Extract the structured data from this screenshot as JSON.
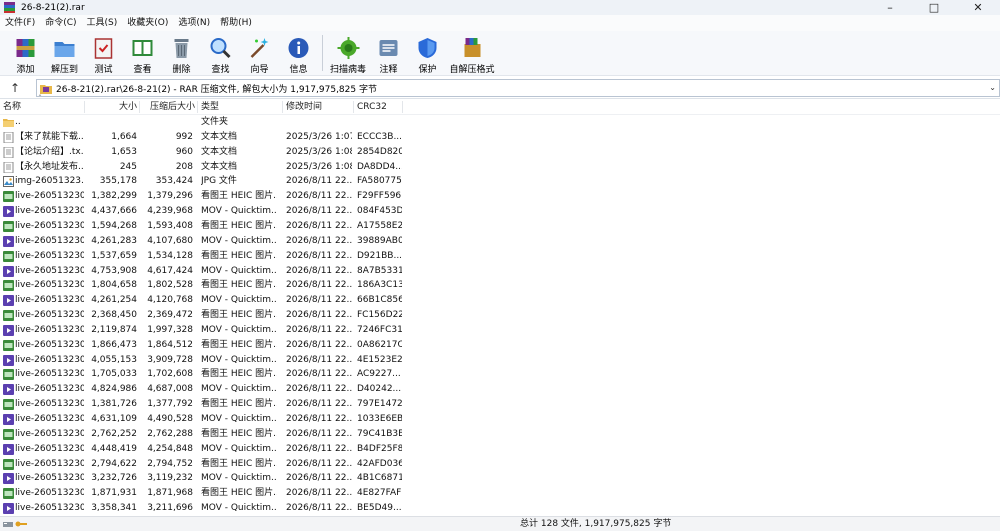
{
  "window": {
    "title": "26-8-21(2).rar"
  },
  "menu": [
    "文件(F)",
    "命令(C)",
    "工具(S)",
    "收藏夹(O)",
    "选项(N)",
    "帮助(H)"
  ],
  "toolbar": {
    "add": "添加",
    "extract_to": "解压到",
    "test": "测试",
    "view": "查看",
    "delete": "删除",
    "find": "查找",
    "wizard": "向导",
    "info": "信息",
    "virus_scan": "扫描病毒",
    "comment": "注释",
    "protect": "保护",
    "sfx": "自解压格式"
  },
  "address": {
    "path": "26-8-21(2).rar\\26-8-21(2) - RAR 压缩文件, 解包大小为 1,917,975,825 字节"
  },
  "columns": {
    "name": "名称",
    "size": "大小",
    "packed": "压缩后大小",
    "type": "类型",
    "mtime": "修改时间",
    "crc": "CRC32"
  },
  "rows": [
    {
      "icon": "folder-up",
      "name": "..",
      "size": "",
      "packed": "",
      "type": "文件夹",
      "mtime": "",
      "crc": ""
    },
    {
      "icon": "text",
      "name": "【来了就能下载...",
      "size": "1,664",
      "packed": "992",
      "type": "文本文档",
      "mtime": "2025/3/26 1:07",
      "crc": "ECCC3B..."
    },
    {
      "icon": "text",
      "name": "【论坛介绍】.tx...",
      "size": "1,653",
      "packed": "960",
      "type": "文本文档",
      "mtime": "2025/3/26 1:08",
      "crc": "2854D820"
    },
    {
      "icon": "text",
      "name": "【永久地址发布...",
      "size": "245",
      "packed": "208",
      "type": "文本文档",
      "mtime": "2025/3/26 1:08",
      "crc": "DA8DD4..."
    },
    {
      "icon": "jpg",
      "name": "img-26051323...",
      "size": "355,178",
      "packed": "353,424",
      "type": "JPG 文件",
      "mtime": "2026/8/11 22...",
      "crc": "FA580775"
    },
    {
      "icon": "heic",
      "name": "live-260513230...",
      "size": "1,382,299",
      "packed": "1,379,296",
      "type": "看图王 HEIC 图片...",
      "mtime": "2026/8/11 22...",
      "crc": "F29FF596"
    },
    {
      "icon": "mov",
      "name": "live-260513230...",
      "size": "4,437,666",
      "packed": "4,239,968",
      "type": "MOV - Quicktim...",
      "mtime": "2026/8/11 22...",
      "crc": "084F453D"
    },
    {
      "icon": "heic",
      "name": "live-260513230...",
      "size": "1,594,268",
      "packed": "1,593,408",
      "type": "看图王 HEIC 图片...",
      "mtime": "2026/8/11 22...",
      "crc": "A17558E2"
    },
    {
      "icon": "mov",
      "name": "live-260513230...",
      "size": "4,261,283",
      "packed": "4,107,680",
      "type": "MOV - Quicktim...",
      "mtime": "2026/8/11 22...",
      "crc": "39889AB0"
    },
    {
      "icon": "heic",
      "name": "live-260513230...",
      "size": "1,537,659",
      "packed": "1,534,128",
      "type": "看图王 HEIC 图片...",
      "mtime": "2026/8/11 22...",
      "crc": "D921BB..."
    },
    {
      "icon": "mov",
      "name": "live-260513230...",
      "size": "4,753,908",
      "packed": "4,617,424",
      "type": "MOV - Quicktim...",
      "mtime": "2026/8/11 22...",
      "crc": "8A7B5331"
    },
    {
      "icon": "heic",
      "name": "live-260513230...",
      "size": "1,804,658",
      "packed": "1,802,528",
      "type": "看图王 HEIC 图片...",
      "mtime": "2026/8/11 22...",
      "crc": "186A3C13"
    },
    {
      "icon": "mov",
      "name": "live-260513230...",
      "size": "4,261,254",
      "packed": "4,120,768",
      "type": "MOV - Quicktim...",
      "mtime": "2026/8/11 22...",
      "crc": "66B1C856"
    },
    {
      "icon": "heic",
      "name": "live-260513230...",
      "size": "2,368,450",
      "packed": "2,369,472",
      "type": "看图王 HEIC 图片...",
      "mtime": "2026/8/11 22...",
      "crc": "FC156D22"
    },
    {
      "icon": "mov",
      "name": "live-260513230...",
      "size": "2,119,874",
      "packed": "1,997,328",
      "type": "MOV - Quicktim...",
      "mtime": "2026/8/11 22...",
      "crc": "7246FC31"
    },
    {
      "icon": "heic",
      "name": "live-260513230...",
      "size": "1,866,473",
      "packed": "1,864,512",
      "type": "看图王 HEIC 图片...",
      "mtime": "2026/8/11 22...",
      "crc": "0A86217C"
    },
    {
      "icon": "mov",
      "name": "live-260513230...",
      "size": "4,055,153",
      "packed": "3,909,728",
      "type": "MOV - Quicktim...",
      "mtime": "2026/8/11 22...",
      "crc": "4E1523E2"
    },
    {
      "icon": "heic",
      "name": "live-260513230...",
      "size": "1,705,033",
      "packed": "1,702,608",
      "type": "看图王 HEIC 图片...",
      "mtime": "2026/8/11 22...",
      "crc": "AC9227..."
    },
    {
      "icon": "mov",
      "name": "live-260513230...",
      "size": "4,824,986",
      "packed": "4,687,008",
      "type": "MOV - Quicktim...",
      "mtime": "2026/8/11 22...",
      "crc": "D40242..."
    },
    {
      "icon": "heic",
      "name": "live-260513230...",
      "size": "1,381,726",
      "packed": "1,377,792",
      "type": "看图王 HEIC 图片...",
      "mtime": "2026/8/11 22...",
      "crc": "797E1472"
    },
    {
      "icon": "mov",
      "name": "live-260513230...",
      "size": "4,631,109",
      "packed": "4,490,528",
      "type": "MOV - Quicktim...",
      "mtime": "2026/8/11 22...",
      "crc": "1033E6EB"
    },
    {
      "icon": "heic",
      "name": "live-260513230...",
      "size": "2,762,252",
      "packed": "2,762,288",
      "type": "看图王 HEIC 图片...",
      "mtime": "2026/8/11 22...",
      "crc": "79C41B3E"
    },
    {
      "icon": "mov",
      "name": "live-260513230...",
      "size": "4,448,419",
      "packed": "4,254,848",
      "type": "MOV - Quicktim...",
      "mtime": "2026/8/11 22...",
      "crc": "B4DF25F8"
    },
    {
      "icon": "heic",
      "name": "live-260513230...",
      "size": "2,794,622",
      "packed": "2,794,752",
      "type": "看图王 HEIC 图片...",
      "mtime": "2026/8/11 22...",
      "crc": "42AFD036"
    },
    {
      "icon": "mov",
      "name": "live-260513230...",
      "size": "3,232,726",
      "packed": "3,119,232",
      "type": "MOV - Quicktim...",
      "mtime": "2026/8/11 22...",
      "crc": "4B1C6871"
    },
    {
      "icon": "heic",
      "name": "live-260513230...",
      "size": "1,871,931",
      "packed": "1,871,968",
      "type": "看图王 HEIC 图片...",
      "mtime": "2026/8/11 22...",
      "crc": "4E827FAF"
    },
    {
      "icon": "mov",
      "name": "live-260513230...",
      "size": "3,358,341",
      "packed": "3,211,696",
      "type": "MOV - Quicktim...",
      "mtime": "2026/8/11 22...",
      "crc": "BE5D49..."
    }
  ],
  "status": {
    "summary": "总计 128 文件, 1,917,975,825 字节"
  },
  "colors": {
    "heic_badge": "#3a8a3a",
    "mov_badge": "#5b3fb0",
    "folder": "#e8b84a"
  }
}
